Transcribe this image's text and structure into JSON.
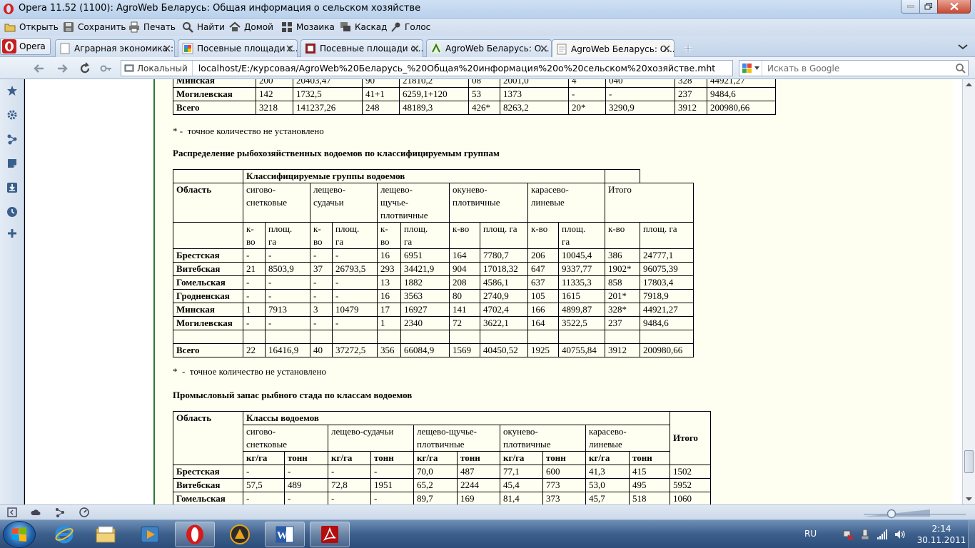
{
  "window": {
    "title": "Opera 11.52 (1100): AgroWeb Беларусь: Общая информация о сельском хозяйстве"
  },
  "menu": {
    "open": "Открыть",
    "save": "Сохранить",
    "print": "Печать",
    "find": "Найти",
    "home": "Домой",
    "mosaic": "Мозаика",
    "cascade": "Каскад",
    "voice": "Голос"
  },
  "opera_button": "Opera",
  "tabs": [
    {
      "label": "Аграрная экономика :..."
    },
    {
      "label": "Посевные площади с..."
    },
    {
      "label": "Посевные площади с..."
    },
    {
      "label": "AgroWeb Беларусь: О..."
    },
    {
      "label": "AgroWeb Беларусь: О..."
    }
  ],
  "address": {
    "local_label": "Локальный",
    "url": "localhost/E:/курсовая/AgroWeb%20Беларусь_%20Общая%20информация%20о%20сельском%20хозяйстве.mht",
    "search_placeholder": "Искать в Google"
  },
  "content": {
    "top_table": {
      "rows": [
        [
          "Минская",
          "200",
          "20403,47",
          "90",
          "21810,2",
          "08",
          "2001,0",
          "4",
          "040",
          "328",
          "44921,27"
        ],
        [
          "Могилевская",
          "142",
          "1732,5",
          "41+1",
          "6259,1+120",
          "53",
          "1373",
          "-",
          "-",
          "237",
          "9484,6"
        ],
        [
          "Всего",
          "3218",
          "141237,26",
          "248",
          "48189,3",
          "426*",
          "8263,2",
          "20*",
          "3290,9",
          "3912",
          "200980,66"
        ]
      ]
    },
    "note1": "* -  точное количество не установлено",
    "heading1": "Распределение рыбохозяйственных водоемов по классифицируемым группам",
    "table2": {
      "group_header": "Классифицируемые группы водоемов",
      "region_header": "Область",
      "groups": [
        "сигово-\nснетковые",
        "лещево-\nсудачьи",
        "лещево-\nщучье-\nплотвичные",
        "окунево-\nплотвичные",
        "карасево-\nлиневые",
        "Итого"
      ],
      "sub": [
        "к-\nво",
        "площ.\nга",
        "к-\nво",
        "площ.\nга",
        "к-\nво",
        "площ.\nга",
        "к-во",
        "площ. га",
        "к-во",
        "площ.\nга",
        "к-во",
        "площ. га"
      ],
      "rows": [
        [
          "Брестская",
          "-",
          "-",
          "-",
          "-",
          "16",
          "6951",
          "164",
          "7780,7",
          "206",
          "10045,4",
          "386",
          "24777,1"
        ],
        [
          "Витебская",
          "21",
          "8503,9",
          "37",
          "26793,5",
          "293",
          "34421,9",
          "904",
          "17018,32",
          "647",
          "9337,77",
          "1902*",
          "96075,39"
        ],
        [
          "Гомельская",
          "-",
          "-",
          "-",
          "-",
          "13",
          "1882",
          "208",
          "4586,1",
          "637",
          "11335,3",
          "858",
          "17803,4"
        ],
        [
          "Гродненская",
          "-",
          "-",
          "-",
          "-",
          "16",
          "3563",
          "80",
          "2740,9",
          "105",
          "1615",
          "201*",
          "7918,9"
        ],
        [
          "Минская",
          "1",
          "7913",
          "3",
          "10479",
          "17",
          "16927",
          "141",
          "4702,4",
          "166",
          "4899,87",
          "328*",
          "44921,27"
        ],
        [
          "Могилевская",
          "-",
          "-",
          "-",
          "-",
          "1",
          "2340",
          "72",
          "3622,1",
          "164",
          "3522,5",
          "237",
          "9484,6"
        ],
        [
          "",
          "",
          "",
          "",
          "",
          "",
          "",
          "",
          "",
          "",
          "",
          "",
          ""
        ],
        [
          "Всего",
          "22",
          "16416,9",
          "40",
          "37272,5",
          "356",
          "66084,9",
          "1569",
          "40450,52",
          "1925",
          "40755,84",
          "3912",
          "200980,66"
        ]
      ]
    },
    "note2": "*  -  точное количество не установлено",
    "heading2": "Промысловый запас рыбного стада по классам водоемов",
    "table3": {
      "region_header": "Область",
      "classes_header": "Классы водоемов",
      "total_header": "Итого",
      "groups": [
        "сигово-\nснетковые",
        "лещево-судачьи",
        "лещево-щучье-\nплотвичные",
        "окунево-\nплотвичные",
        "карасево-\nлиневые"
      ],
      "sub": [
        "кг/га",
        "тонн",
        "кг/га",
        "тонн",
        "кг/га",
        "тонн",
        "кг/га",
        "тонн",
        "кг/га",
        "тонн"
      ],
      "rows": [
        [
          "Брестская",
          "-",
          "-",
          "-",
          "-",
          "70,0",
          "487",
          "77,1",
          "600",
          "41,3",
          "415",
          "1502"
        ],
        [
          "Витебская",
          "57,5",
          "489",
          "72,8",
          "1951",
          "65,2",
          "2244",
          "45,4",
          "773",
          "53,0",
          "495",
          "5952"
        ],
        [
          "Гомельская",
          "-",
          "-",
          "-",
          "-",
          "89,7",
          "169",
          "81,4",
          "373",
          "45,7",
          "518",
          "1060"
        ]
      ]
    }
  },
  "tray": {
    "lang": "RU",
    "time": "2:14",
    "date": "30.11.2011"
  }
}
